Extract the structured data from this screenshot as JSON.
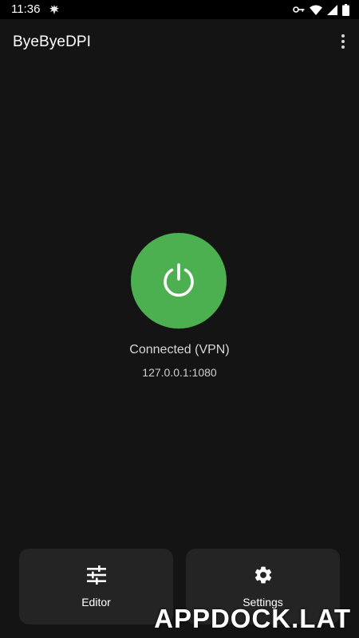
{
  "status_bar": {
    "time": "11:36",
    "icons": [
      "app-notification-icon",
      "vpn-key-icon",
      "wifi-icon",
      "cellular-signal-icon",
      "battery-icon"
    ]
  },
  "app_bar": {
    "title": "ByeByeDPI",
    "menu_icon": "more-vert-icon"
  },
  "main": {
    "power_button_icon": "power-icon",
    "power_button_color": "#4caf50",
    "status": "Connected (VPN)",
    "address": "127.0.0.1:1080"
  },
  "bottom_actions": [
    {
      "label": "Editor",
      "icon": "tune-sliders-icon"
    },
    {
      "label": "Settings",
      "icon": "gear-icon"
    }
  ],
  "watermark": "APPDOCK.LAT",
  "colors": {
    "background": "#141414",
    "card": "#242424",
    "accent": "#4caf50"
  }
}
